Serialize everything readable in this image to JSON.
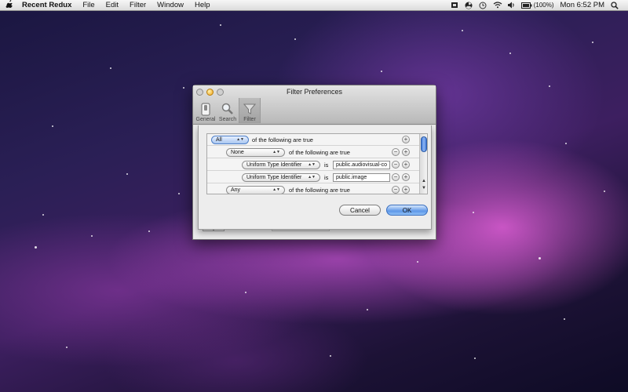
{
  "menubar": {
    "apple": "",
    "app_name": "Recent Redux",
    "menus": [
      "File",
      "Edit",
      "Filter",
      "Window",
      "Help"
    ],
    "battery": "(100%)",
    "clock": "Mon 6:52 PM"
  },
  "window": {
    "title": "Filter Preferences",
    "toolbar": [
      {
        "label": "General",
        "icon": "switch-icon"
      },
      {
        "label": "Search",
        "icon": "magnifier-icon"
      },
      {
        "label": "Filter",
        "icon": "funnel-icon",
        "selected": true
      }
    ]
  },
  "rules": [
    {
      "quantifier": "All",
      "text": "of the following are true",
      "level": 0
    },
    {
      "quantifier": "None",
      "text": "of the following are true",
      "level": 1
    },
    {
      "attribute": "Uniform Type Identifier",
      "operator": "is",
      "value": "public.audiovisual-co",
      "level": 2
    },
    {
      "attribute": "Uniform Type Identifier",
      "operator": "is",
      "value": "public.image",
      "level": 2
    },
    {
      "quantifier": "Any",
      "text": "of the following are true",
      "level": 1
    }
  ],
  "buttons": {
    "cancel": "Cancel",
    "ok": "OK",
    "add": "+",
    "remove": "−"
  },
  "colors": {
    "accent": "#5e98e8",
    "selected_popup": "#a9c6f0"
  }
}
